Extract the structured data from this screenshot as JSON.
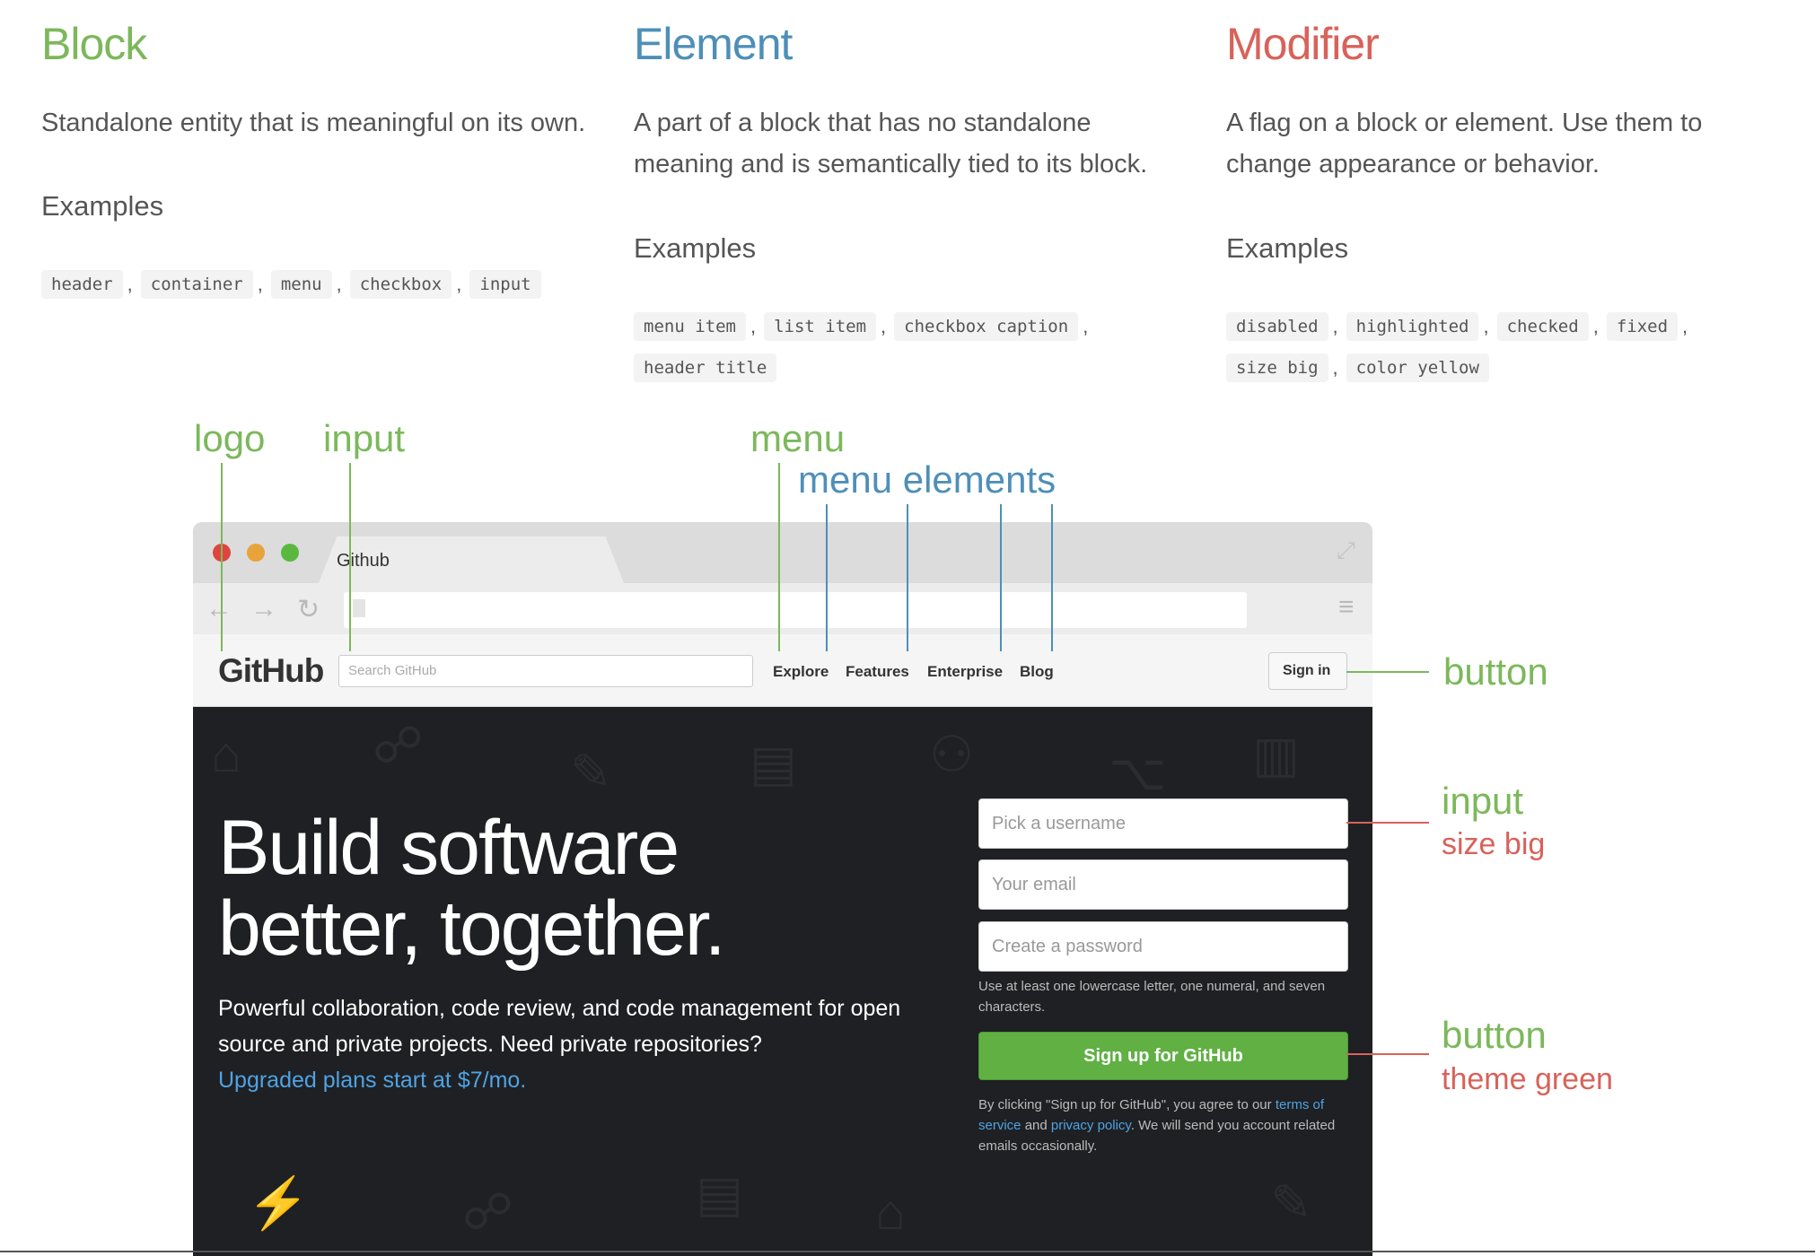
{
  "columns": [
    {
      "title": "Block",
      "color": "#7cb85b",
      "description": "Standalone entity that is meaningful on its own.",
      "examples_heading": "Examples",
      "examples": [
        "header",
        "container",
        "menu",
        "checkbox",
        "input"
      ]
    },
    {
      "title": "Element",
      "color": "#4e8fb8",
      "description": "A part of a block that has no standalone meaning and is semantically tied to its block.",
      "examples_heading": "Examples",
      "examples": [
        "menu item",
        "list item",
        "checkbox caption",
        "header title"
      ]
    },
    {
      "title": "Modifier",
      "color": "#d8625a",
      "description": "A flag on a block or element. Use them to change appearance or behavior.",
      "examples_heading": "Examples",
      "examples": [
        "disabled",
        "highlighted",
        "checked",
        "fixed",
        "size big",
        "color yellow"
      ]
    }
  ],
  "annotations": {
    "logo": "logo",
    "input_top": "input",
    "menu": "menu",
    "menu_elements": "menu elements",
    "button_signin": "button",
    "input_form": "input",
    "input_modifier": "size big",
    "button_signup": "button",
    "button_modifier": "theme green"
  },
  "browser": {
    "tab_title": "Github",
    "logo": "GitHub",
    "search_placeholder": "Search GitHub",
    "menu": [
      "Explore",
      "Features",
      "Enterprise",
      "Blog"
    ],
    "sign_in": "Sign in",
    "headline_line1": "Build software",
    "headline_line2": "better, together.",
    "lede": "Powerful collaboration, code review, and code management for open source and private projects. Need private repositories?",
    "lede_link": "Upgraded plans start at $7/mo.",
    "fields": [
      "Pick a username",
      "Your email",
      "Create a password"
    ],
    "password_hint": "Use at least one lowercase letter, one numeral, and seven characters.",
    "signup_button": "Sign up for GitHub",
    "legal_prefix": "By clicking \"Sign up for GitHub\", you agree to our",
    "legal_terms": "terms of service",
    "legal_and": "and",
    "legal_privacy": "privacy policy",
    "legal_suffix": ". We will send you account related emails occasionally."
  },
  "colors": {
    "block": "#7cb85b",
    "element": "#4e8fb8",
    "modifier": "#d8625a",
    "signup_green": "#60b044",
    "link_blue": "#4ea3e4"
  },
  "icons": [
    "close-dot-icon",
    "minimize-dot-icon",
    "maximize-dot-icon",
    "back-arrow-icon",
    "forward-arrow-icon",
    "reload-icon",
    "page-icon",
    "menu-icon",
    "fullscreen-icon"
  ]
}
